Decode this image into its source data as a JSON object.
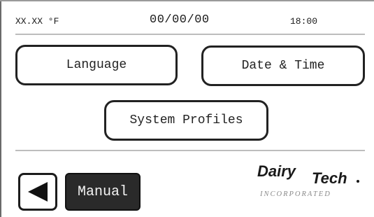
{
  "status_bar": {
    "temperature": "XX.XX °F",
    "date": "00/00/00",
    "time": "18:00"
  },
  "buttons": {
    "language": "Language",
    "date_time": "Date & Time",
    "system_profiles": "System Profiles",
    "manual": "Manual"
  },
  "icons": {
    "back": "left-triangle-icon"
  },
  "logo": {
    "name": "DairyTech",
    "tagline": "INCORPORATED"
  },
  "colors": {
    "manual_button_bg": "#2a2a2a",
    "border": "#222222",
    "divider": "#bdbdbd"
  }
}
